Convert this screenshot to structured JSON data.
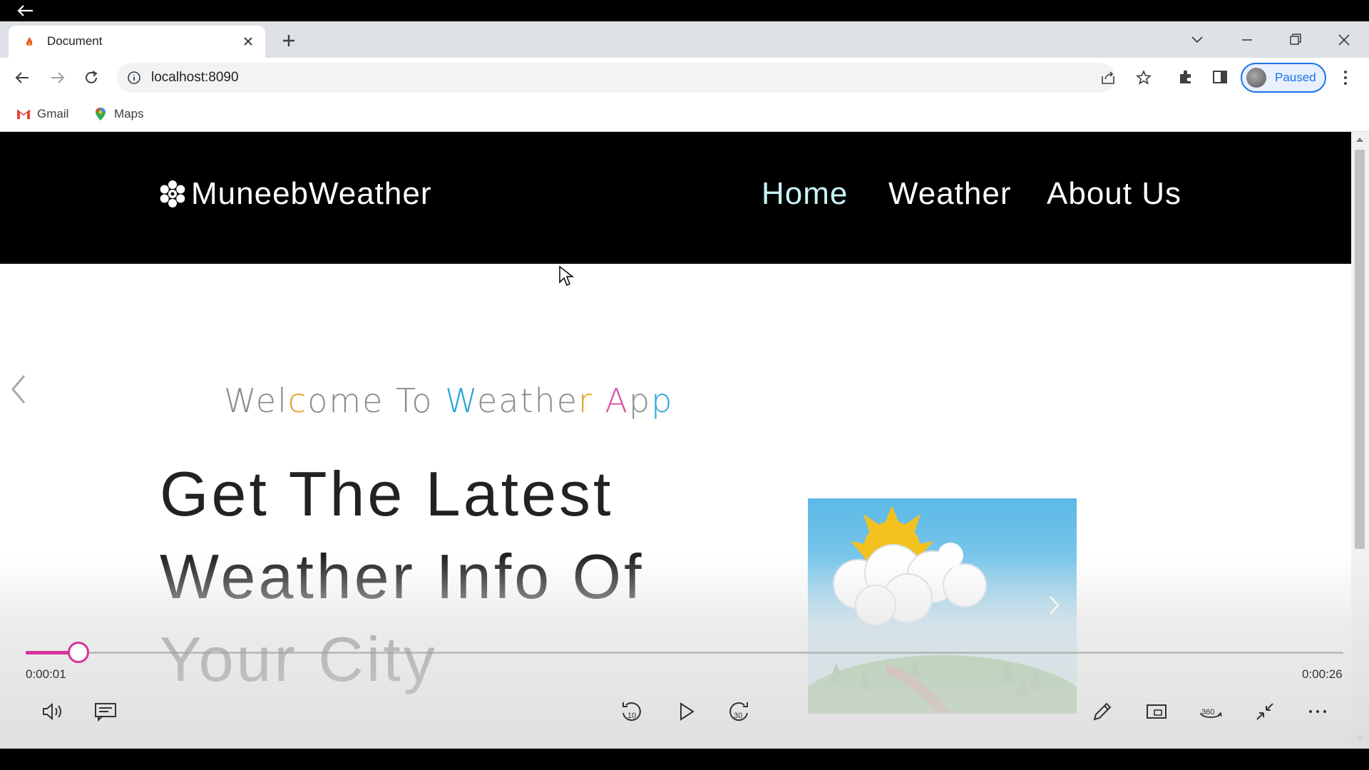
{
  "browser": {
    "tab_title": "Document",
    "url": "localhost:8090",
    "profile_label": "Paused",
    "bookmarks": [
      {
        "label": "Gmail"
      },
      {
        "label": "Maps"
      }
    ]
  },
  "site": {
    "brand": "MuneebWeather",
    "nav": [
      "Home",
      "Weather",
      "About Us"
    ],
    "welcome": "Welcome To Weather App",
    "headline": "Get The Latest Weather Info Of Your City"
  },
  "player": {
    "current_time": "0:00:01",
    "total_time": "0:00:26",
    "progress": 0.04,
    "accent": "#d6339b"
  },
  "colors": {
    "nav_bg": "#000000",
    "nav_active": "#c7f3f7"
  }
}
